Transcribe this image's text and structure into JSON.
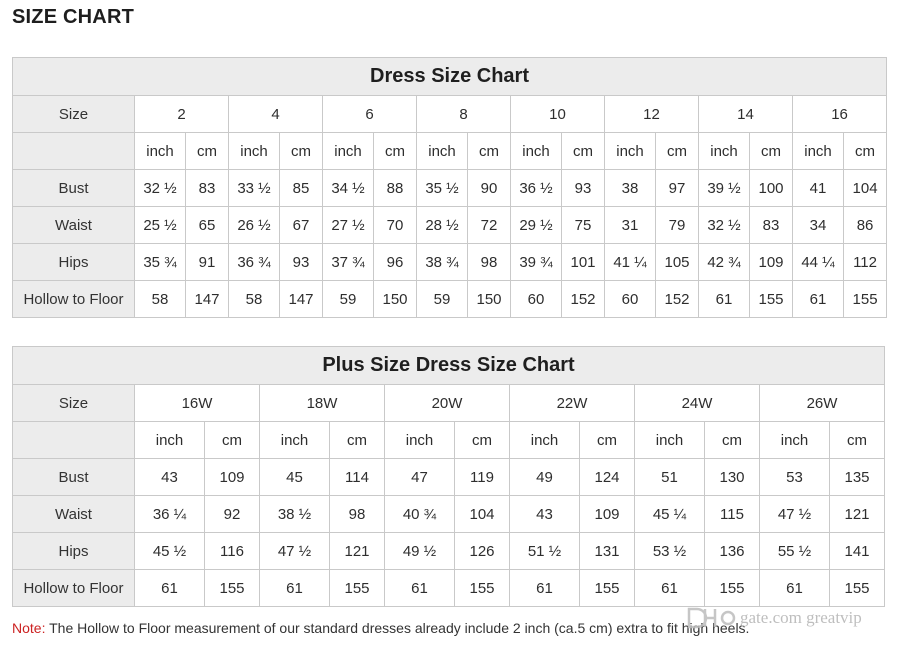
{
  "heading": "SIZE CHART",
  "dress_chart": {
    "title": "Dress Size Chart",
    "size_label": "Size",
    "sizes": [
      "2",
      "4",
      "6",
      "8",
      "10",
      "12",
      "14",
      "16"
    ],
    "unit_inch": "inch",
    "unit_cm": "cm",
    "rows": [
      {
        "label": "Bust",
        "values": [
          "32 ½",
          "83",
          "33 ½",
          "85",
          "34 ½",
          "88",
          "35 ½",
          "90",
          "36 ½",
          "93",
          "38",
          "97",
          "39 ½",
          "100",
          "41",
          "104"
        ]
      },
      {
        "label": "Waist",
        "values": [
          "25 ½",
          "65",
          "26 ½",
          "67",
          "27 ½",
          "70",
          "28 ½",
          "72",
          "29 ½",
          "75",
          "31",
          "79",
          "32 ½",
          "83",
          "34",
          "86"
        ]
      },
      {
        "label": "Hips",
        "values": [
          "35 ¾",
          "91",
          "36 ¾",
          "93",
          "37 ¾",
          "96",
          "38 ¾",
          "98",
          "39 ¾",
          "101",
          "41 ¼",
          "105",
          "42 ¾",
          "109",
          "44 ¼",
          "112"
        ]
      },
      {
        "label": "Hollow to Floor",
        "values": [
          "58",
          "147",
          "58",
          "147",
          "59",
          "150",
          "59",
          "150",
          "60",
          "152",
          "60",
          "152",
          "61",
          "155",
          "61",
          "155"
        ]
      }
    ]
  },
  "plus_chart": {
    "title": "Plus Size Dress Size Chart",
    "size_label": "Size",
    "sizes": [
      "16W",
      "18W",
      "20W",
      "22W",
      "24W",
      "26W"
    ],
    "unit_inch": "inch",
    "unit_cm": "cm",
    "rows": [
      {
        "label": "Bust",
        "values": [
          "43",
          "109",
          "45",
          "114",
          "47",
          "119",
          "49",
          "124",
          "51",
          "130",
          "53",
          "135"
        ]
      },
      {
        "label": "Waist",
        "values": [
          "36 ¼",
          "92",
          "38 ½",
          "98",
          "40 ¾",
          "104",
          "43",
          "109",
          "45 ¼",
          "115",
          "47 ½",
          "121"
        ]
      },
      {
        "label": "Hips",
        "values": [
          "45 ½",
          "116",
          "47 ½",
          "121",
          "49 ½",
          "126",
          "51 ½",
          "131",
          "53 ½",
          "136",
          "55 ½",
          "141"
        ]
      },
      {
        "label": "Hollow to Floor",
        "values": [
          "61",
          "155",
          "61",
          "155",
          "61",
          "155",
          "61",
          "155",
          "61",
          "155",
          "61",
          "155"
        ]
      }
    ]
  },
  "note": {
    "label": "Note:",
    "text": " The Hollow to Floor measurement of our standard dresses already include 2 inch (ca.5 cm) extra to fit high heels."
  },
  "watermark": {
    "text": "gate.com  greatvip"
  }
}
